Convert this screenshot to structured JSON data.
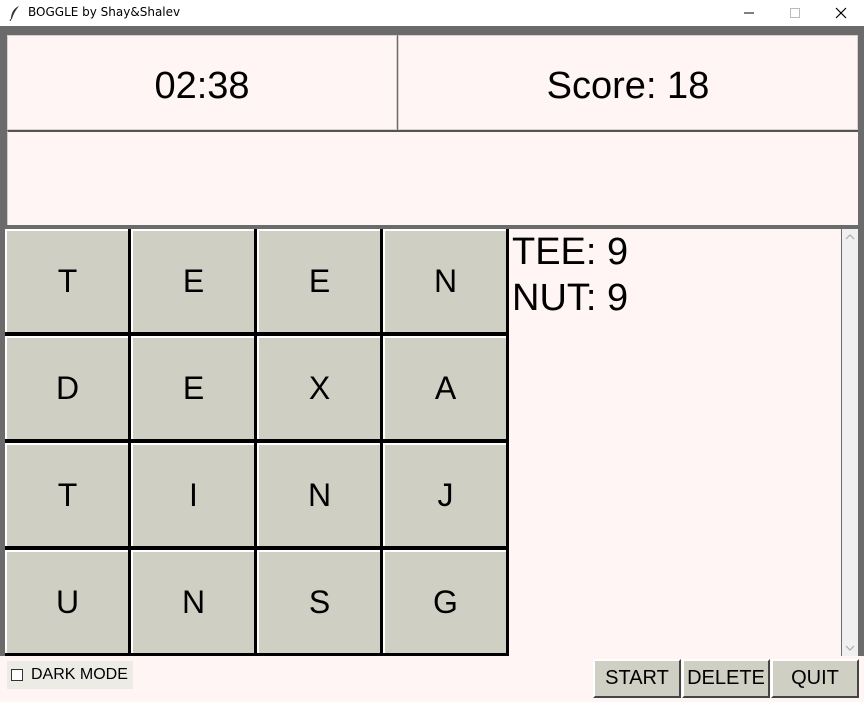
{
  "window": {
    "title": "BOGGLE by Shay&Shalev",
    "minimize": "—",
    "maximize": "□",
    "close": "✕"
  },
  "timer": "02:38",
  "score": "Score: 18",
  "current_word": "",
  "board": [
    [
      "T",
      "E",
      "E",
      "N"
    ],
    [
      "D",
      "E",
      "X",
      "A"
    ],
    [
      "T",
      "I",
      "N",
      "J"
    ],
    [
      "U",
      "N",
      "S",
      "G"
    ]
  ],
  "found_words": [
    "TEE: 9",
    "NUT: 9"
  ],
  "controls": {
    "dark_mode_label": "DARK MODE",
    "dark_mode_checked": false,
    "start": "START",
    "delete": "DELETE",
    "quit": "QUIT"
  },
  "colors": {
    "panel_bg": "#fff5f5",
    "cell_bg": "#cfcfc4",
    "button_bg": "#cfcfc4"
  }
}
